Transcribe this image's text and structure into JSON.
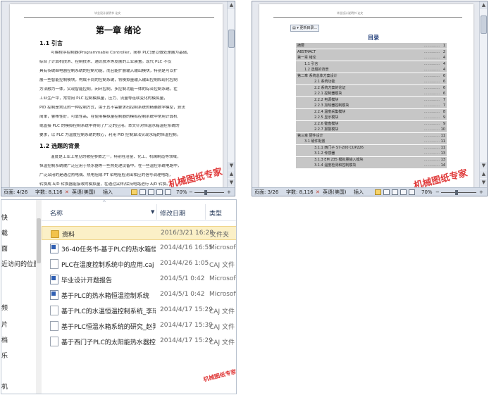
{
  "left_doc": {
    "header_text": "毕业设计说明书 论文",
    "chapter_title": "第一章  绪论",
    "sections": [
      {
        "title": "1.1  引言",
        "lines": [
          "可编程序控制器(Programmable Controller，简称 PLC)是以微处理器为基础，",
          "综合了计算机技术、控制技术、通讯技术等发展的工业装置。现代 PLC 不仅",
          "具有传统继电器控制系统的控制功能，而且能扩展输入输出模块，特别是可以扩",
          "展一些智能控制模块，构成不同的控制系统，将模拟量输入输出控制和现代控制",
          "方法融为一体，实现智能控制，闭环控制，多控制功能一体的综合控制系统。在",
          "工业生产中，常常用 PLC 控制模拟量，压力、流量等连续变化的模拟量，",
          "PID 控制是常见的一种控制方式，由于其不需要求出控制系统的精确数学模型，算法",
          "简单，鲁棒性好，可靠性高，在使用模拟量控制器的模拟控制系统中常用计算机",
          "或直接 PLC 的模拟控制系统中得到了广泛的应用。本文针对恒温水箱温控系统的",
          "要求，以 PLC 为温度控制系统的核心，利用 PID 控制算法实现水箱的恒温控制。"
        ]
      },
      {
        "title": "1.2  选题的背景",
        "lines": [
          "温度是工业上常见的被控参数之一，特别在冶金、化工、机械制造等领域，",
          "恒温控制系统被广泛应用于热水器等一些热处理设备中。在一些温控系统电路中，",
          "广泛采用的是通过热电偶、热电阻或 PT 铂电阻检测出相应的信号调理电路，",
          "转换成 A/D 转换器能接收的模拟量，在通过采样/保持电路进行 A/D 转换。"
        ]
      }
    ],
    "watermark": "机械图纸专家",
    "status": {
      "page": "页面: 4/26",
      "words": "字数: 8,116",
      "lang": "英语(美国)",
      "mode": "插入",
      "zoom": "70%"
    }
  },
  "right_doc": {
    "header_text": "毕业设计说明书 论文",
    "toc_buttons": [
      "更新目录..."
    ],
    "toc_title": "目录",
    "toc": [
      {
        "label": "摘要",
        "page": "1",
        "level": 0
      },
      {
        "label": "ABSTRACT",
        "page": "2",
        "level": 0
      },
      {
        "label": "第一章  绪论",
        "page": "4",
        "level": 0
      },
      {
        "label": "1.1  引言",
        "page": "4",
        "level": 1
      },
      {
        "label": "1.2 选题的背景",
        "page": "4",
        "level": 1
      },
      {
        "label": "第二章  系统总体方案设计",
        "page": "6",
        "level": 0
      },
      {
        "label": "2.1  系统功能",
        "page": "6",
        "level": 2
      },
      {
        "label": "2.2  系统方案的论证",
        "page": "6",
        "level": 2
      },
      {
        "label": "2.2.1  控制器模块",
        "page": "6",
        "level": 2
      },
      {
        "label": "2.2.2  电源模块",
        "page": "7",
        "level": 2
      },
      {
        "label": "2.2.3  加热器控制模块",
        "page": "7",
        "level": 2
      },
      {
        "label": "2.2.4  温度采集模块",
        "page": "8",
        "level": 2
      },
      {
        "label": "2.2.5  显示模块",
        "page": "9",
        "level": 2
      },
      {
        "label": "2.2.6  键盘模块",
        "page": "9",
        "level": 2
      },
      {
        "label": "2.2.7  报警模块",
        "page": "10",
        "level": 2
      },
      {
        "label": "第三章  硬件设计",
        "page": "11",
        "level": 0
      },
      {
        "label": "3.1  硬件配置",
        "page": "11",
        "level": 1
      },
      {
        "label": "3.1.1  西门子 S7-200 CUP226",
        "page": "11",
        "level": 2
      },
      {
        "label": "3.1.2  传感器",
        "page": "13",
        "level": 2
      },
      {
        "label": "3.1.3  EM 235 模拟量输入模块",
        "page": "13",
        "level": 2
      },
      {
        "label": "3.1.4  温度检测和控制模块",
        "page": "14",
        "level": 2
      }
    ],
    "watermark": "机械图纸专家",
    "status": {
      "page": "页面: 3/26",
      "words": "字数: 8,116",
      "lang": "英语(美国)",
      "mode": "插入",
      "zoom": "70%"
    }
  },
  "explorer": {
    "nav_items": [
      "快",
      "载",
      "面",
      "近访问的位置",
      "频",
      "片",
      "档",
      "乐",
      "机"
    ],
    "columns": {
      "name": "名称",
      "date": "修改日期",
      "type": "类型"
    },
    "files": [
      {
        "icon": "folder-icon",
        "name": "资料",
        "date": "2016/3/21 16:28",
        "type": "文件夹",
        "selected": true
      },
      {
        "icon": "word-doc-icon",
        "name": "36-40任务书-基于PLC的热水箱恒温控制...",
        "date": "2014/4/16 16:55",
        "type": "Microsoft W"
      },
      {
        "icon": "caj-file-icon",
        "name": "PLC在温度控制系统中的应用.caj",
        "date": "2014/4/26 1:05",
        "type": "CAJ 文件"
      },
      {
        "icon": "word-doc-icon",
        "name": "毕业设计开题报告",
        "date": "2014/5/1 0:42",
        "type": "Microsoft W"
      },
      {
        "icon": "word-doc-icon",
        "name": "基于PLC的热水箱恒温控制系统",
        "date": "2014/5/1 0:42",
        "type": "Microsoft W"
      },
      {
        "icon": "caj-file-icon",
        "name": "基于PLC的水温恒温控制系统_李琦.caj",
        "date": "2014/4/17 15:29",
        "type": "CAJ 文件"
      },
      {
        "icon": "caj-file-icon",
        "name": "基于PLC恒温水箱系统的研究_赵羿伟.caj",
        "date": "2014/4/17 15:39",
        "type": "CAJ 文件"
      },
      {
        "icon": "caj-file-icon",
        "name": "基于西门子PLC的太阳能热水器控制系统...",
        "date": "2014/4/17 15:29",
        "type": "CAJ 文件"
      }
    ],
    "watermark": "机械图纸专家"
  },
  "colors": {
    "toc_highlight": "#c6c6c6",
    "toc_title": "#1f3c78",
    "watermark": "#e03c3c",
    "selected_row": "#fbf0c7",
    "folder": "#f2c24b"
  }
}
